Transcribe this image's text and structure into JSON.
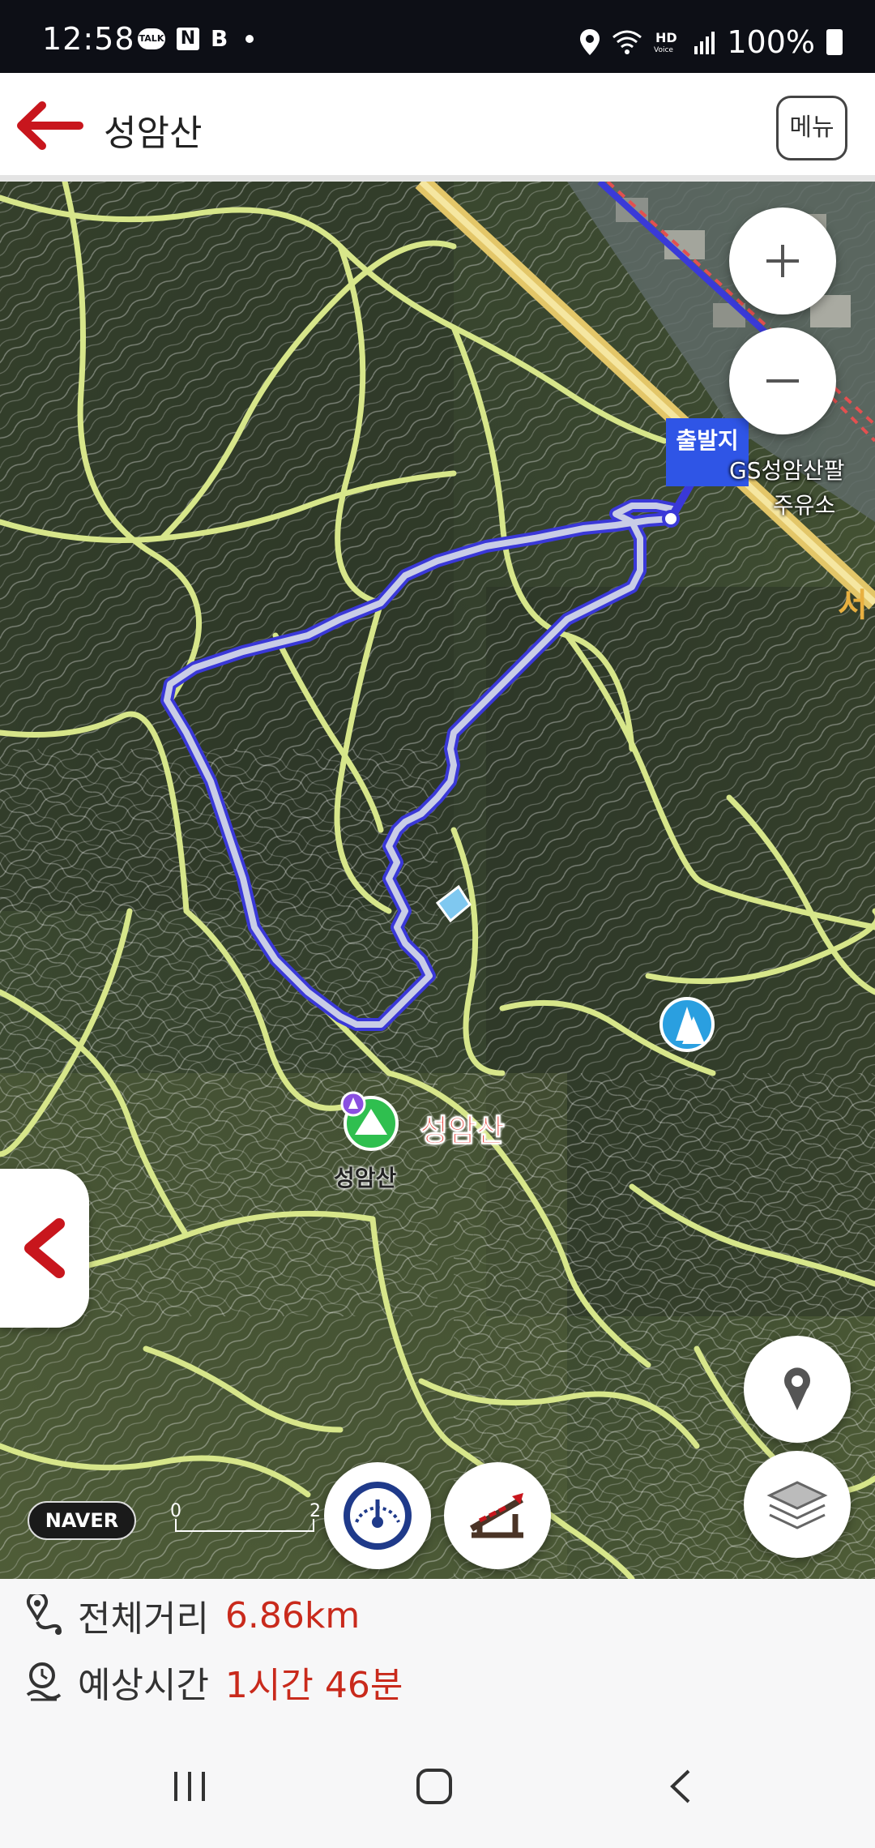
{
  "status_bar": {
    "time": "12:58",
    "battery": "100%",
    "left_icons": [
      "talk-icon",
      "n-icon",
      "b-icon",
      "dot-icon"
    ],
    "right_icons": [
      "location-pin-icon",
      "wifi-icon",
      "hd-voice-icon",
      "signal-icon",
      "battery-icon"
    ]
  },
  "header": {
    "title": "성암산",
    "menu_label": "메뉴",
    "back_icon": "back-arrow-icon"
  },
  "map": {
    "start_label": "출발지",
    "poi_name": "GS성암산팔",
    "poi_name_line2": "주유소",
    "summit_label_red": "성암산",
    "summit_label": "성암산",
    "edge_label": "서",
    "attribution": "NAVER",
    "scale_zero": "0",
    "scale_max": "2",
    "colors": {
      "route": "#3a38d8",
      "trail": "#d7e68a",
      "summit_marker": "#2fbf4f"
    }
  },
  "info": {
    "distance_label": "전체거리",
    "distance_value": "6.86km",
    "time_label": "예상시간",
    "time_value": "1시간 46분"
  },
  "nav_bar": {
    "icons": [
      "recent-apps-icon",
      "home-icon",
      "back-icon"
    ]
  }
}
